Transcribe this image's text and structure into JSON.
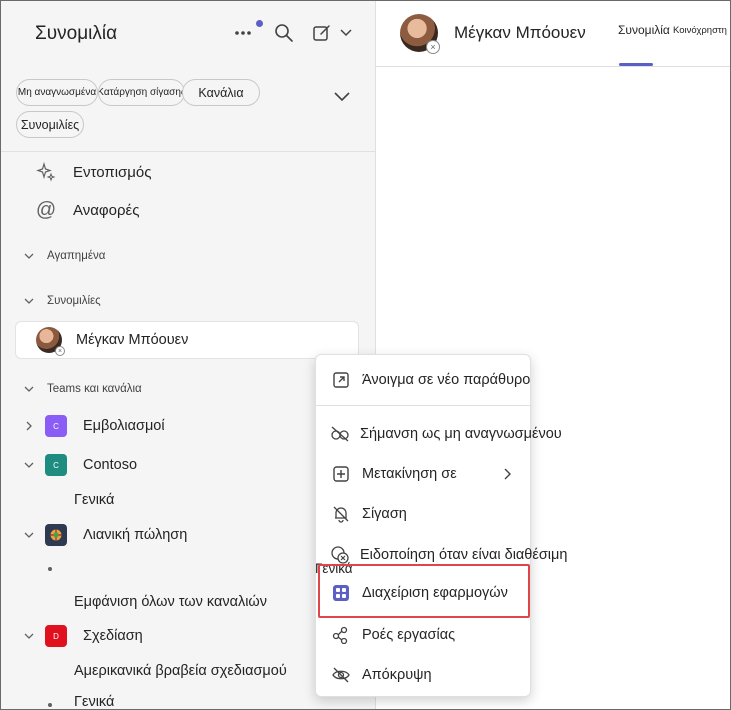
{
  "sidebar": {
    "title": "Συνομιλία",
    "filters": [
      "Μη αναγνωσμένα",
      "Κατάργηση σίγασης",
      "Κανάλια",
      "Συνομιλίες"
    ],
    "nav": [
      {
        "label": "Εντοπισμός",
        "icon": "sparkle-icon"
      },
      {
        "label": "Αναφορές",
        "icon": "at-sign-icon"
      }
    ],
    "sections": {
      "favorites": "Αγαπημένα",
      "chats": "Συνομιλίες",
      "teams": "Teams και κανάλια"
    },
    "chat_item": {
      "name": "Μέγκαν Μπόουεν"
    },
    "teams": [
      {
        "name": "Εμβολιασμοί",
        "tile_letter": "C",
        "tile_color": "#8b5cf6"
      },
      {
        "name": "Contoso",
        "tile_letter": "C",
        "tile_color": "#1e8c7e"
      },
      {
        "name": "Λιανική πώληση",
        "tile_letter": "",
        "tile_color": "#2d3a52"
      },
      {
        "name": "Σχεδίαση",
        "tile_letter": "D",
        "tile_color": "#e0101e"
      }
    ],
    "channels": {
      "contoso_general": "Γενικά",
      "show_all": "Εμφάνιση όλων των καναλιών",
      "design_awards": "Αμερικανικά βραβεία σχεδιασμού",
      "design_general": "Γενικά"
    }
  },
  "header": {
    "name": "Μέγκαν Μπόουεν",
    "tabs": [
      "Συνομιλία",
      "Κοινόχρηστη"
    ]
  },
  "context_menu": {
    "items": [
      {
        "label": "Άνοιγμα σε νέο παράθυρο",
        "icon": "open-new-window-icon"
      },
      {
        "label": "Σήμανση ως μη αναγνωσμένου",
        "icon": "mark-unread-icon"
      },
      {
        "label": "Μετακίνηση σε",
        "icon": "add-square-icon"
      },
      {
        "label": "Σίγαση",
        "icon": "bell-off-icon"
      },
      {
        "label": "Ειδοποίηση όταν είναι διαθέσιμη",
        "icon": "notify-available-icon"
      },
      {
        "label": "Διαχείριση εφαρμογών",
        "icon": "apps-grid-icon"
      },
      {
        "label": "Ροές εργασίας",
        "icon": "workflows-icon"
      },
      {
        "label": "Απόκρυψη",
        "icon": "eye-off-icon"
      }
    ],
    "overlap_label": "Γενικά"
  },
  "colors": {
    "accent": "#5b5fc7",
    "highlight_border": "#e0454a",
    "apps_icon": "#5b5fc7"
  }
}
